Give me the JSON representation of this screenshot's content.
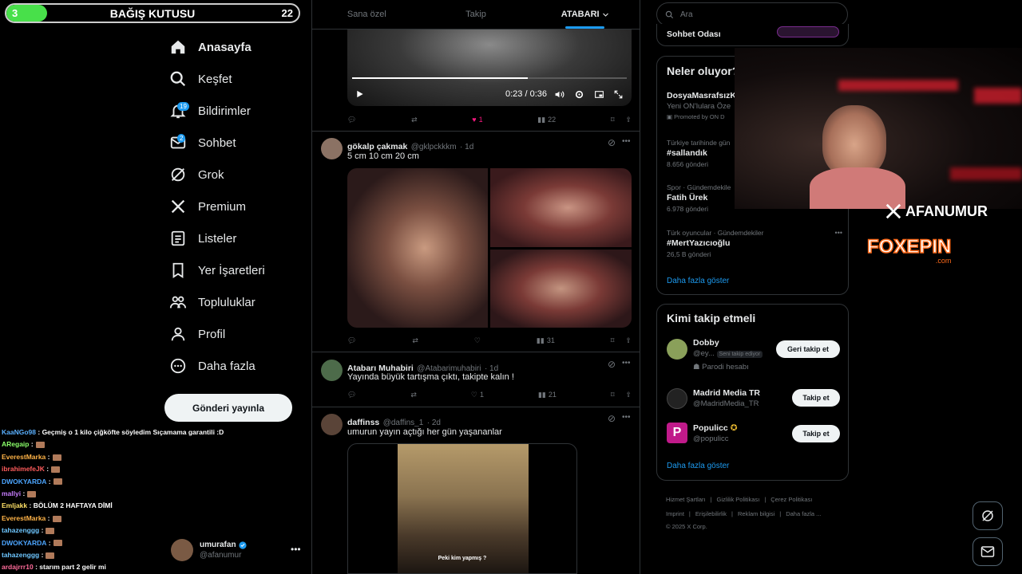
{
  "donation": {
    "title": "BAĞIŞ KUTUSU",
    "current": "3",
    "goal": "22",
    "fill_fraction": 0.14,
    "accent": "#48e04a"
  },
  "sidebar": {
    "items": [
      {
        "label": "Anasayfa",
        "icon": "home-icon",
        "active": true
      },
      {
        "label": "Keşfet",
        "icon": "search-icon"
      },
      {
        "label": "Bildirimler",
        "icon": "bell-icon",
        "badge": "19"
      },
      {
        "label": "Sohbet",
        "icon": "mail-icon",
        "badge": "2"
      },
      {
        "label": "Grok",
        "icon": "grok-icon"
      },
      {
        "label": "Premium",
        "icon": "x-logo-icon"
      },
      {
        "label": "Listeler",
        "icon": "list-icon"
      },
      {
        "label": "Yer İşaretleri",
        "icon": "bookmark-icon"
      },
      {
        "label": "Topluluklar",
        "icon": "communities-icon"
      },
      {
        "label": "Profil",
        "icon": "profile-icon"
      },
      {
        "label": "Daha fazla",
        "icon": "more-circle-icon"
      }
    ],
    "post_button": "Gönderi yayınla",
    "user": {
      "name": "umurafan",
      "handle": "@afanumur"
    }
  },
  "chat": [
    {
      "user": "KaaNGo98",
      "color": "#5ab0ff",
      "text": ": Geçmiş o 1 kilo çiğköfte söyledim Sıçamama garantili :D"
    },
    {
      "user": "ARegaip",
      "color": "#8bff6a",
      "text": ":",
      "emote": true
    },
    {
      "user": "EverestMarka",
      "color": "#ffb347",
      "text": ":",
      "emote": true
    },
    {
      "user": "ibrahimefeJK",
      "color": "#ff5c5c",
      "text": ":",
      "emote": true
    },
    {
      "user": "DWOKYARDA",
      "color": "#4da6ff",
      "text": ":",
      "emote": true
    },
    {
      "user": "mallyi",
      "color": "#c77dff",
      "text": ":",
      "emote": true
    },
    {
      "user": "Emljakk",
      "color": "#ffe066",
      "text": ": BÖLÜM 2 HAFTAYA DİMİ"
    },
    {
      "user": "EverestMarka",
      "color": "#ffb347",
      "text": ":",
      "emote": true
    },
    {
      "user": "tahazenggg",
      "color": "#6ec6ff",
      "text": ":",
      "emote": true
    },
    {
      "user": "DWOKYARDA",
      "color": "#4da6ff",
      "text": ":",
      "emote": true
    },
    {
      "user": "tahazenggg",
      "color": "#6ec6ff",
      "text": ":",
      "emote": true
    },
    {
      "user": "ardajrrr10",
      "color": "#ff6b9a",
      "text": ": starım part 2 gelir mi"
    }
  ],
  "feed": {
    "tabs": [
      {
        "label": "Sana özel"
      },
      {
        "label": "Takip"
      },
      {
        "label": "ATABARI",
        "active": true
      }
    ],
    "video_post": {
      "time": "0:23 / 0:36",
      "progress": 0.64,
      "likes": "1",
      "views": "22"
    },
    "posts": [
      {
        "name": "gökalp çakmak",
        "handle": "@gklpckkkm",
        "age": "· 1d",
        "text": "5 cm  10 cm  20 cm",
        "views": "31"
      },
      {
        "name": "Atabarı Muhabiri",
        "handle": "@Atabarimuhabiri",
        "age": "· 1d",
        "text": "Yayında büyük tartışma çıktı, takipte kalın !",
        "likes": "1",
        "views": "21"
      },
      {
        "name": "daffinss",
        "handle": "@daffins_1",
        "age": "· 2d",
        "text": "umurun yayın açtığı her gün yaşananlar",
        "caption": "Peki kim yapmış ?"
      }
    ]
  },
  "right": {
    "search_placeholder": "Ara",
    "chat_room": "Sohbet Odası",
    "trends_title": "Neler oluyor?",
    "trends": [
      {
        "ctx": "",
        "title": "DosyaMasrafsızK",
        "sub": "Yeni ON'lulara Öze",
        "promo": "Promoted by ON D"
      },
      {
        "ctx": "Türkiye tarihinde gün",
        "title": "#sallandık",
        "sub": "8.656 gönderi"
      },
      {
        "ctx": "Spor · Gündemdekile",
        "title": "Fatih Ürek",
        "sub": "6.978 gönderi"
      },
      {
        "ctx": "Türk oyuncular · Gündemdekiler",
        "title": "#MertYazıcıoğlu",
        "sub": "26,5 B gönderi"
      }
    ],
    "show_more": "Daha fazla göster",
    "who_title": "Kimi takip etmeli",
    "who": [
      {
        "name": "Dobby",
        "handle": "@ey...",
        "tag": "Seni takip ediyor",
        "note": "Parodi hesabı",
        "button": "Geri takip et"
      },
      {
        "name": "Madrid Media TR",
        "handle": "@MadridMedia_TR",
        "button": "Takip et"
      },
      {
        "name": "Populicc",
        "handle": "@populicc",
        "button": "Takip et"
      }
    ],
    "who_more": "Daha fazla göster",
    "footer": [
      "Hizmet Şartları",
      "Gizlilik Politikası",
      "Çerez Politikası",
      "Imprint",
      "Erişilebilirlik",
      "Reklam bilgisi",
      "Daha fazla ..."
    ],
    "copyright": "© 2025 X Corp."
  },
  "overlay": {
    "streamer": "AFANUMUR",
    "sponsor": "FOXEPIN",
    "sponsor_suffix": ".com"
  }
}
